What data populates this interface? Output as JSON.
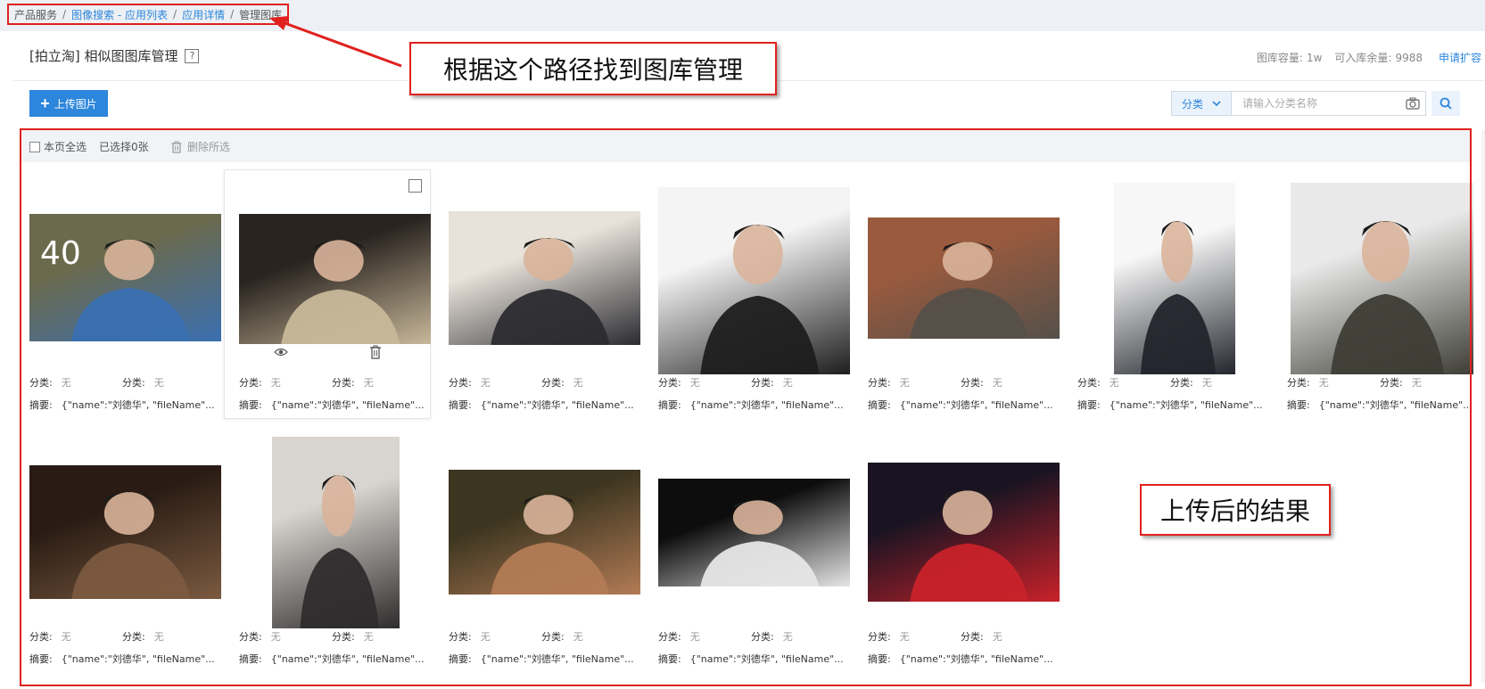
{
  "breadcrumb": {
    "items": [
      {
        "label": "产品服务",
        "link": false
      },
      {
        "label": "图像搜索 - 应用列表",
        "link": true
      },
      {
        "label": "应用详情",
        "link": true
      },
      {
        "label": "管理图库",
        "link": false
      }
    ],
    "separator": "/"
  },
  "header": {
    "title": "[拍立淘] 相似图图库管理",
    "help": "?",
    "capacity_label": "图库容量:",
    "capacity_value": "1w",
    "remaining_label": "可入库余量:",
    "remaining_value": "9988",
    "apply_label": "申请扩容"
  },
  "toolbar": {
    "upload_label": "上传图片",
    "select_all_label": "本页全选",
    "selected_label": "已选择0张",
    "delete_label": "删除所选"
  },
  "search": {
    "category_label": "分类",
    "placeholder": "请输入分类名称"
  },
  "card_labels": {
    "category": "分类:",
    "category_value": "无",
    "summary": "摘要:",
    "summary_value": "{\"name\":\"刘德华\", \"fileName\"..."
  },
  "annotations": {
    "path_note": "根据这个路径找到图库管理",
    "result_note": "上传后的结果"
  },
  "images": [
    {
      "row": 1,
      "overlay_text": "40"
    },
    {
      "row": 1
    },
    {
      "row": 1
    },
    {
      "row": 1
    },
    {
      "row": 1
    },
    {
      "row": 1
    },
    {
      "row": 1
    },
    {
      "row": 2
    },
    {
      "row": 2
    },
    {
      "row": 2
    },
    {
      "row": 2
    },
    {
      "row": 2
    }
  ],
  "colors": {
    "accent": "#2c86db",
    "annotation_red": "#e0211e",
    "top_bar": "#edf0f4"
  }
}
